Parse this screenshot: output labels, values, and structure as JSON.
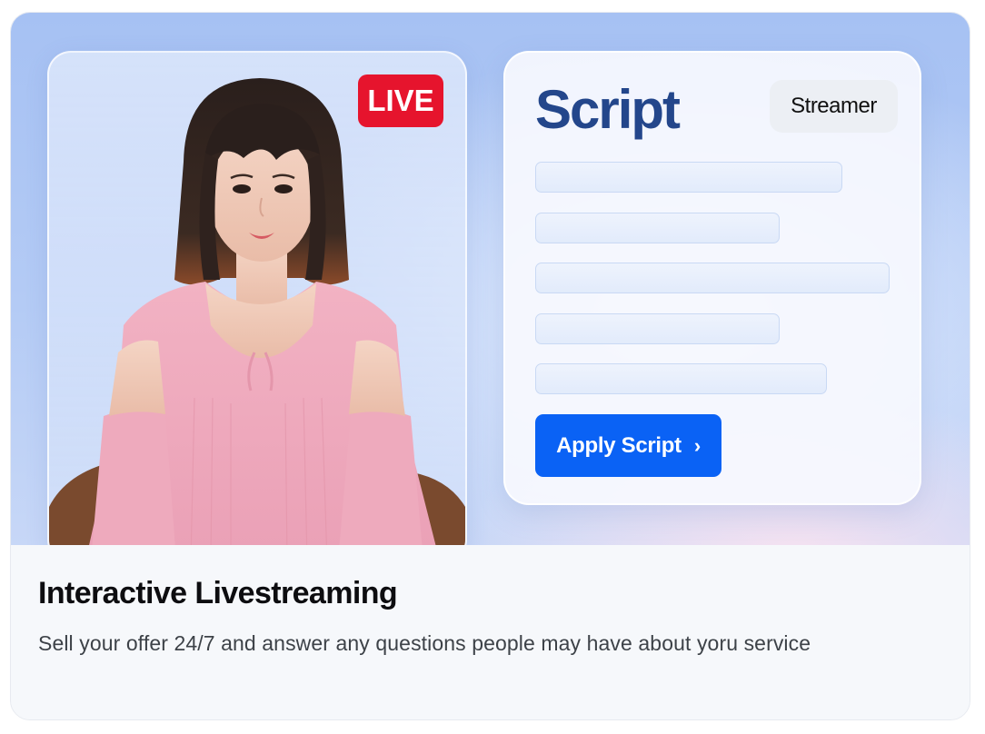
{
  "card": {
    "badge_live": "LIVE",
    "script_panel": {
      "title": "Script",
      "tag": "Streamer",
      "apply_label": "Apply Script",
      "apply_icon": "chevron-right-icon"
    },
    "title": "Interactive Livestreaming",
    "description": "Sell your offer 24/7 and answer any questions people may have about yoru service"
  },
  "colors": {
    "live_red": "#e6142d",
    "script_blue": "#23468b",
    "button_blue": "#0a62f5",
    "hero_blue": "#a6c1f3"
  }
}
